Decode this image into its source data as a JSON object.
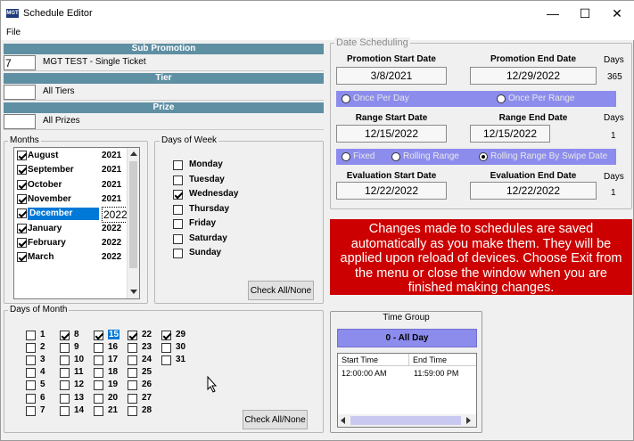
{
  "window": {
    "title": "Schedule Editor",
    "logo_text": "MGT",
    "min": "—",
    "max": "☐",
    "close": "✕"
  },
  "menu": {
    "file": "File"
  },
  "sub_promotion": {
    "header": "Sub Promotion",
    "id": "7",
    "name": "MGT TEST - Single Ticket"
  },
  "tier": {
    "header": "Tier",
    "value": "All Tiers"
  },
  "prize": {
    "header": "Prize",
    "value": "All Prizes"
  },
  "months": {
    "legend": "Months",
    "items": [
      {
        "month": "August",
        "year": "2021",
        "checked": true
      },
      {
        "month": "September",
        "year": "2021",
        "checked": true
      },
      {
        "month": "October",
        "year": "2021",
        "checked": true
      },
      {
        "month": "November",
        "year": "2021",
        "checked": true
      },
      {
        "month": "December",
        "year": "2022",
        "checked": true,
        "selected": true
      },
      {
        "month": "January",
        "year": "2022",
        "checked": true
      },
      {
        "month": "February",
        "year": "2022",
        "checked": true
      },
      {
        "month": "March",
        "year": "2022",
        "checked": true
      }
    ]
  },
  "days_of_week": {
    "legend": "Days of Week",
    "days": [
      {
        "label": "Monday",
        "checked": false
      },
      {
        "label": "Tuesday",
        "checked": false
      },
      {
        "label": "Wednesday",
        "checked": true
      },
      {
        "label": "Thursday",
        "checked": false
      },
      {
        "label": "Friday",
        "checked": false
      },
      {
        "label": "Saturday",
        "checked": false
      },
      {
        "label": "Sunday",
        "checked": false
      }
    ],
    "button": "Check All/None"
  },
  "days_of_month": {
    "legend": "Days of Month",
    "button": "Check All/None",
    "checked_days": [
      8,
      15,
      22,
      29
    ],
    "selected_day": 15
  },
  "date_scheduling": {
    "legend": "Date Scheduling",
    "promo_start_label": "Promotion Start Date",
    "promo_start": "3/8/2021",
    "promo_end_label": "Promotion End Date",
    "promo_end": "12/29/2022",
    "days_label": "Days",
    "promo_days": "365",
    "radio1": {
      "once_per_day": "Once Per Day",
      "once_per_range": "Once Per Range",
      "selected": "none"
    },
    "range_start_label": "Range Start Date",
    "range_start": "12/15/2022",
    "range_end_label": "Range End Date",
    "range_end": "12/15/2022",
    "range_days": "1",
    "radio2": {
      "fixed": "Fixed",
      "rolling": "Rolling Range",
      "swipe": "Rolling Range By Swipe Date",
      "selected": "swipe"
    },
    "eval_start_label": "Evaluation Start Date",
    "eval_start": "12/22/2022",
    "eval_end_label": "Evaluation End Date",
    "eval_end": "12/22/2022",
    "eval_days": "1"
  },
  "notice": {
    "text": "Changes made to schedules  are saved automatically as you make them. They will be applied upon reload of devices. Choose Exit from the menu or close the window when you are finished making changes.",
    "bg": "#cc0000"
  },
  "time_group": {
    "legend": "Time Group",
    "selected": "0 - All Day",
    "col_start": "Start Time",
    "col_end": "End Time",
    "rows": [
      {
        "start": "12:00:00 AM",
        "end": "11:59:00 PM"
      }
    ]
  },
  "colors": {
    "header": "#5e8fa3",
    "radio_bar": "#8c8ced",
    "selection": "#0078d7"
  }
}
